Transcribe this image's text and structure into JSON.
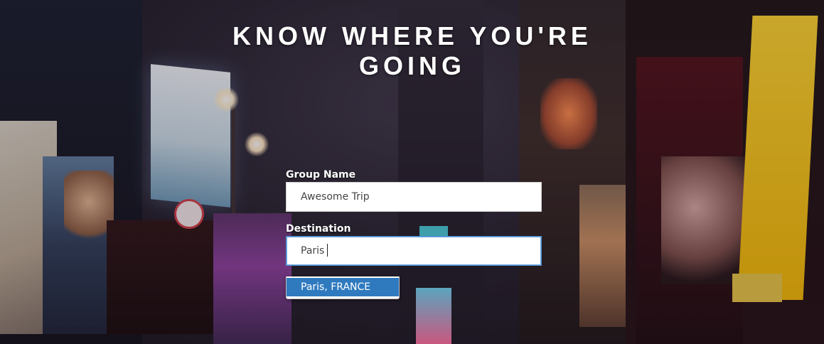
{
  "hero": {
    "title": "KNOW WHERE YOU'RE GOING"
  },
  "form": {
    "group_name": {
      "label": "Group Name",
      "value": "Awesome Trip"
    },
    "destination": {
      "label": "Destination",
      "value": "Paris"
    },
    "autocomplete": {
      "options": [
        "Paris, FRANCE"
      ],
      "highlighted_index": 0
    }
  },
  "colors": {
    "highlight": "#2f7abf",
    "focus_border": "#4f8fd0",
    "title_text": "#ffffff"
  }
}
